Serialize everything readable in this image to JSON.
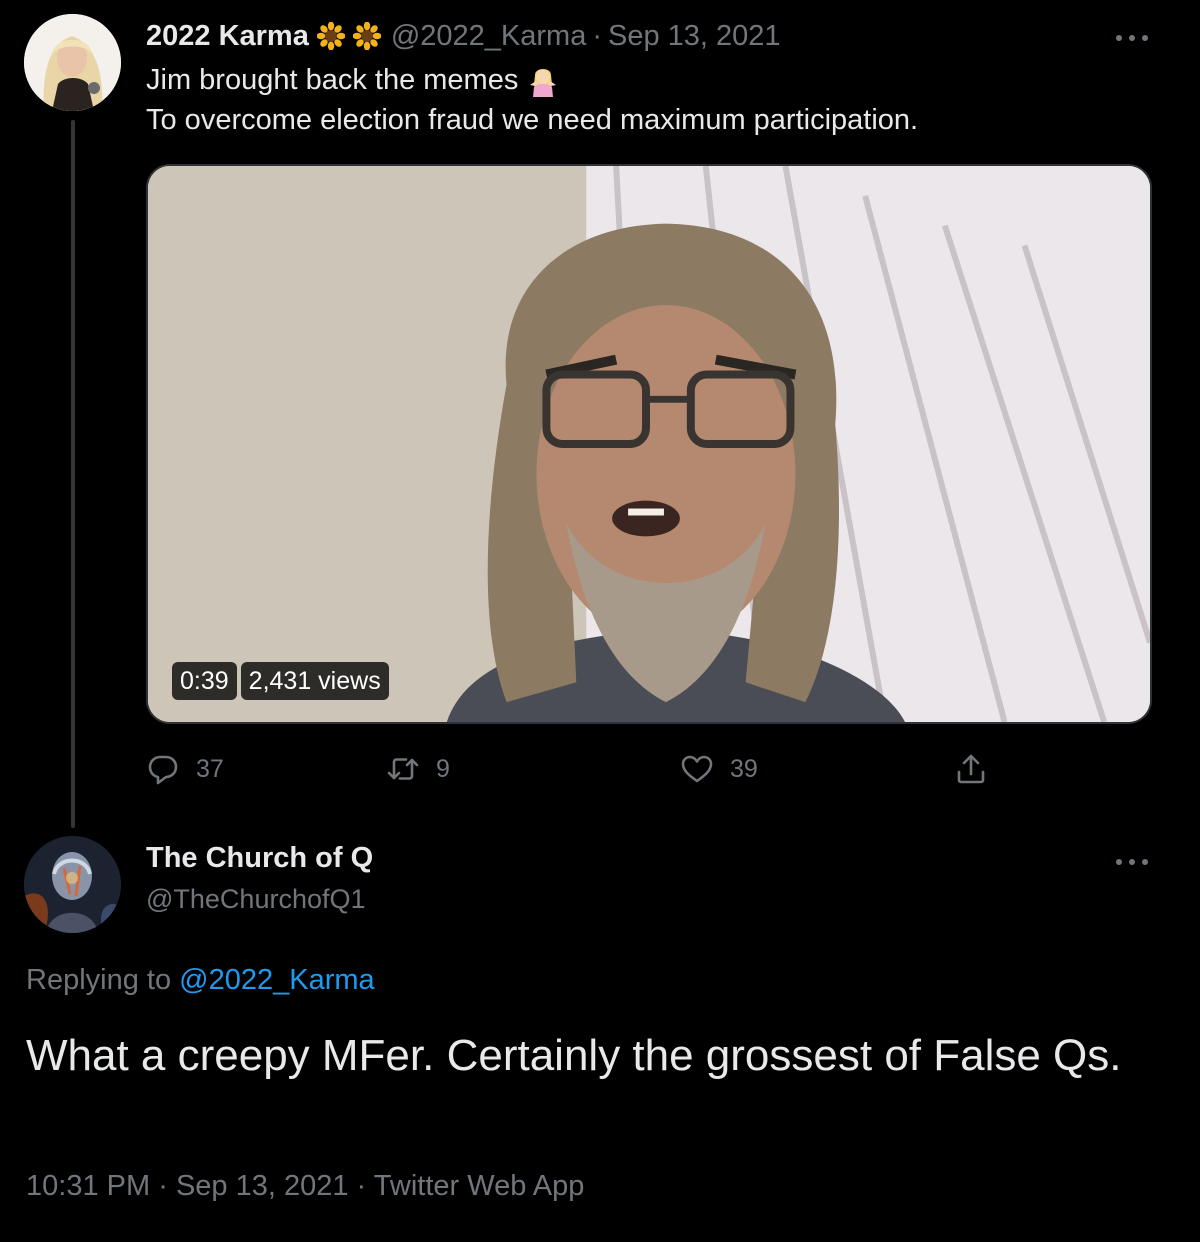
{
  "thread": {
    "tweet1": {
      "display_name": "2022 Karma",
      "name_icons": [
        "sunflower-icon",
        "sunflower-icon"
      ],
      "handle": "@2022_Karma",
      "separator": "·",
      "date": "Sep 13, 2021",
      "text_line1": "Jim brought back the memes",
      "text_line1_emoji": "woman-shrugging-icon",
      "text_line2": "To overcome election fraud we need maximum participation.",
      "video": {
        "duration": "0:39",
        "views": "2,431 views"
      },
      "actions": {
        "replies": "37",
        "retweets": "9",
        "likes": "39"
      }
    },
    "tweet2": {
      "display_name": "The Church of Q",
      "handle": "@TheChurchofQ1",
      "replying_prefix": "Replying to",
      "replying_to": "@2022_Karma",
      "text": "What a creepy MFer. Certainly the grossest of False Qs.",
      "time": "10:31 PM",
      "date": "Sep 13, 2021",
      "source": "Twitter Web App",
      "separator": "·"
    }
  },
  "colors": {
    "background": "#000000",
    "text_primary": "#e7e9ea",
    "text_secondary": "#71767b",
    "link": "#1d9bf0",
    "border": "#2f3336"
  }
}
